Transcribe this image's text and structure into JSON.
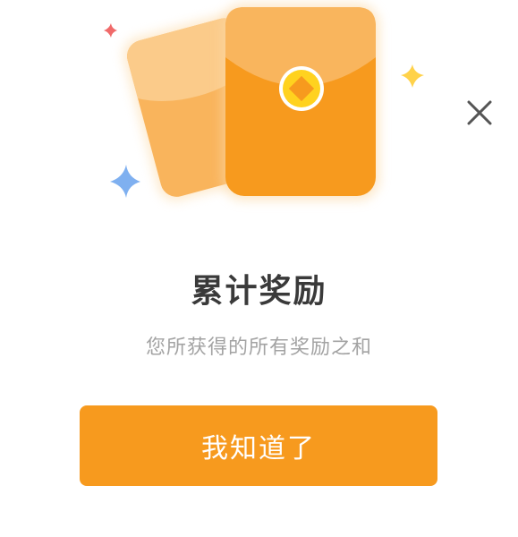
{
  "dialog": {
    "title": "累计奖励",
    "subtitle": "您所获得的所有奖励之和",
    "confirm_label": "我知道了"
  },
  "icons": {
    "close": "close-icon",
    "illustration": "red-envelope-icon"
  },
  "colors": {
    "accent": "#f79a1e",
    "envelope_back": "#f9b45c",
    "coin": "#ffd21f",
    "sparkle_yellow": "#ffd24a",
    "sparkle_blue": "#7fb0f0",
    "sparkle_red": "#f06a6a",
    "title": "#3a3a3a",
    "subtitle": "#a3a3a3"
  }
}
